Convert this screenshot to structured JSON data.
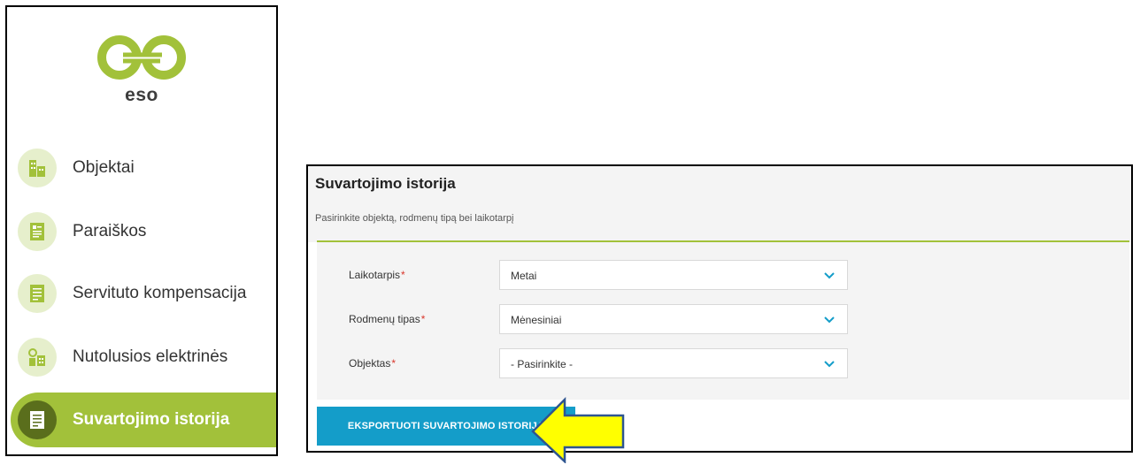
{
  "brand": {
    "logo_text": "eso",
    "accent_color": "#a2c13a"
  },
  "sidebar": {
    "items": [
      {
        "label": "Objektai",
        "icon": "buildings-icon",
        "active": false
      },
      {
        "label": "Paraiškos",
        "icon": "application-form-icon",
        "active": false
      },
      {
        "label": "Servituto kompensacija",
        "icon": "document-icon",
        "active": false
      },
      {
        "label": "Nutolusios elektrinės",
        "icon": "power-plant-icon",
        "active": false
      },
      {
        "label": "Suvartojimo istorija",
        "icon": "history-document-icon",
        "active": true
      }
    ]
  },
  "form": {
    "title": "Suvartojimo istorija",
    "subtitle": "Pasirinkite objektą, rodmenų tipą bei laikotarpį",
    "required_marker": "*",
    "fields": [
      {
        "label": "Laikotarpis",
        "value": "Metai"
      },
      {
        "label": "Rodmenų tipas",
        "value": "Mėnesiniai"
      },
      {
        "label": "Objektas",
        "value": "- Pasirinkite -"
      }
    ],
    "export_label": "EKSPORTUOTI SUVARTOJIMO ISTORIJĄ",
    "button_color": "#149dc9",
    "callout_arrow_color": "#ffff00"
  }
}
